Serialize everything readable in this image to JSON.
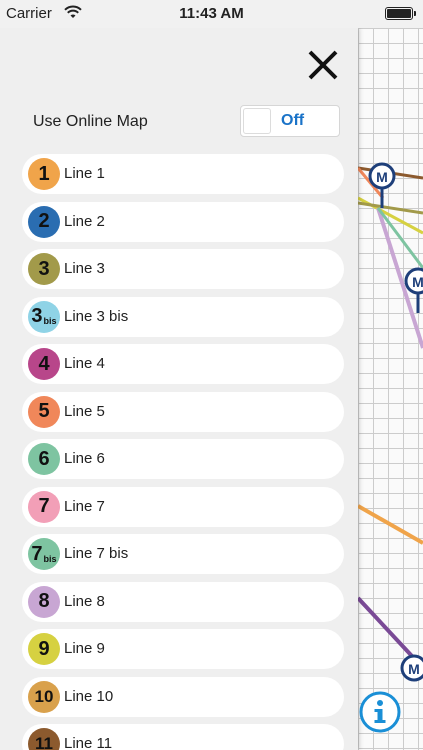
{
  "status_bar": {
    "carrier": "Carrier",
    "time": "11:43 AM",
    "wifi_icon": "wifi-icon",
    "battery_icon": "battery-icon"
  },
  "header": {
    "close_label": "X"
  },
  "online_map": {
    "label": "Use Online Map",
    "toggle_state": "Off"
  },
  "lines": [
    {
      "badge": "1",
      "bis": "",
      "label": "Line 1",
      "color": "#f0a44a"
    },
    {
      "badge": "2",
      "bis": "",
      "label": "Line 2",
      "color": "#2a6db1"
    },
    {
      "badge": "3",
      "bis": "",
      "label": "Line 3",
      "color": "#a29a4a"
    },
    {
      "badge": "3",
      "bis": "bis",
      "label": "Line 3 bis",
      "color": "#8fd3e6"
    },
    {
      "badge": "4",
      "bis": "",
      "label": "Line 4",
      "color": "#b8468a"
    },
    {
      "badge": "5",
      "bis": "",
      "label": "Line 5",
      "color": "#f0875a"
    },
    {
      "badge": "6",
      "bis": "",
      "label": "Line 6",
      "color": "#7ec4a1"
    },
    {
      "badge": "7",
      "bis": "",
      "label": "Line 7",
      "color": "#f29fb7"
    },
    {
      "badge": "7",
      "bis": "bis",
      "label": "Line 7 bis",
      "color": "#7ec4a1"
    },
    {
      "badge": "8",
      "bis": "",
      "label": "Line 8",
      "color": "#c8a6d3"
    },
    {
      "badge": "9",
      "bis": "",
      "label": "Line 9",
      "color": "#d6d141"
    },
    {
      "badge": "10",
      "bis": "",
      "label": "Line 10",
      "color": "#d9a14c"
    },
    {
      "badge": "11",
      "bis": "",
      "label": "Line 11",
      "color": "#8c5a2e"
    }
  ],
  "info_icon": "info-icon",
  "metro_icon": "metro-station-icon",
  "accent_color": "#1a73c8"
}
